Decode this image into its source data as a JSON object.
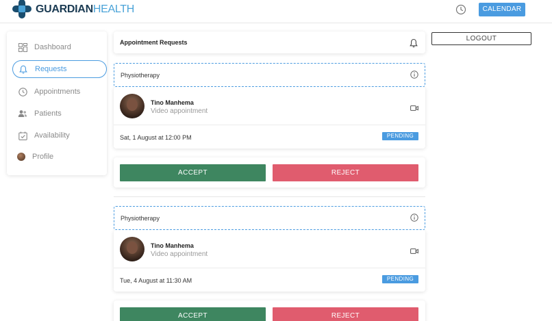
{
  "brand": {
    "name_bold": "GUARDIAN",
    "name_light": "HEALTH",
    "logo_icon": "medical-cross-logo"
  },
  "header": {
    "calendar_label": "CALENDAR",
    "clock_icon": "clock-icon"
  },
  "sidebar": {
    "items": [
      {
        "label": "Dashboard",
        "icon": "dashboard-icon",
        "active": false
      },
      {
        "label": "Requests",
        "icon": "bell-icon",
        "active": true
      },
      {
        "label": "Appointments",
        "icon": "clock-icon",
        "active": false
      },
      {
        "label": "Patients",
        "icon": "users-icon",
        "active": false
      },
      {
        "label": "Availability",
        "icon": "calendar-check-icon",
        "active": false
      },
      {
        "label": "Profile",
        "icon": "avatar",
        "active": false
      }
    ]
  },
  "main": {
    "title": "Appointment Requests",
    "requests": [
      {
        "category": "Physiotherapy",
        "patient_name": "Tino Manhema",
        "appointment_type": "Video appointment",
        "datetime": "Sat, 1 August at 12:00 PM",
        "status": "PENDING",
        "accept_label": "ACCEPT",
        "reject_label": "REJECT"
      },
      {
        "category": "Physiotherapy",
        "patient_name": "Tino Manhema",
        "appointment_type": "Video appointment",
        "datetime": "Tue, 4 August at 11:30 AM",
        "status": "PENDING",
        "accept_label": "ACCEPT",
        "reject_label": "REJECT"
      }
    ]
  },
  "aside": {
    "logout_label": "LOGOUT"
  },
  "colors": {
    "brand_dark": "#1a4d6e",
    "accent": "#4a9be0",
    "accept": "#3e8660",
    "reject": "#e05c6e"
  }
}
